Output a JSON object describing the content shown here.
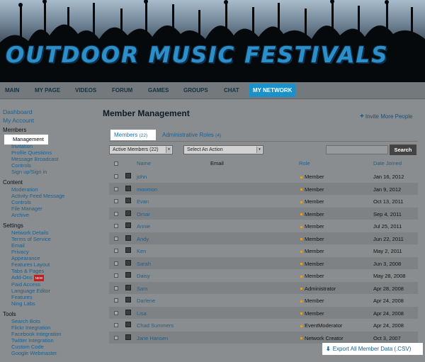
{
  "banner": {
    "title": "OUTDOOR MUSIC FESTIVALS"
  },
  "nav": {
    "items": [
      {
        "label": "MAIN"
      },
      {
        "label": "MY PAGE"
      },
      {
        "label": "VIDEOS"
      },
      {
        "label": "FORUM"
      },
      {
        "label": "GAMES"
      },
      {
        "label": "GROUPS"
      },
      {
        "label": "CHAT"
      },
      {
        "label": "MY NETWORK",
        "active": true
      }
    ]
  },
  "sidebar": {
    "dashboard": "Dashboard",
    "my_account": "My Account",
    "members_heading": "Members",
    "members_items": [
      "Management",
      "Invitation",
      "Profile Questions",
      "Message Broadcast",
      "Controls",
      "Sign up/Sign in"
    ],
    "content_heading": "Content",
    "content_items": [
      "Moderation",
      "Activity Feed Message",
      "Controls",
      "File Manager",
      "Archive"
    ],
    "settings_heading": "Settings",
    "settings_items": [
      "Network Details",
      "Terms of Service",
      "Email",
      "Privacy",
      "Appearance",
      "Features Layout",
      "Tabs & Pages",
      "Add-Ons",
      "Paid Access",
      "Language Editor",
      "Features",
      "Ning Labs"
    ],
    "new_badge": "NEW",
    "tools_heading": "Tools",
    "tools_items": [
      "Search Bots",
      "Flickr Integration",
      "Facebook Integration",
      "Twitter Integration",
      "Custom Code",
      "Google Webmaster"
    ]
  },
  "main": {
    "title": "Member Management",
    "invite_label": "Invite More People",
    "tabs": {
      "members_label": "Members",
      "members_count": "(22)",
      "admin_label": "Administrative Roles",
      "admin_count": "(4)"
    },
    "filter_select": "Active Members (22)",
    "action_select": "Select An Action",
    "search_button": "Search",
    "columns": {
      "name": "Name",
      "email": "Email",
      "role": "Role",
      "date": "Date Joined"
    },
    "members": [
      {
        "name": "john",
        "role": "Member",
        "date": "Jan 16, 2012"
      },
      {
        "name": "monmon",
        "role": "Member",
        "date": "Jan 9, 2012"
      },
      {
        "name": "Evan",
        "role": "Member",
        "date": "Oct 13, 2011"
      },
      {
        "name": "Omar",
        "role": "Member",
        "date": "Sep 4, 2011"
      },
      {
        "name": "Annie",
        "role": "Member",
        "date": "Jul 25, 2011"
      },
      {
        "name": "Andy",
        "role": "Member",
        "date": "Jun 22, 2011"
      },
      {
        "name": "Ken",
        "role": "Member",
        "date": "May 2, 2011"
      },
      {
        "name": "Sarah",
        "role": "Member",
        "date": "Jun 3, 2008"
      },
      {
        "name": "Daisy",
        "role": "Member",
        "date": "May 28, 2008"
      },
      {
        "name": "Sam",
        "role": "Administrator",
        "date": "Apr 28, 2008"
      },
      {
        "name": "Darlene",
        "role": "Member",
        "date": "Apr 24, 2008"
      },
      {
        "name": "Lisa",
        "role": "Member",
        "date": "Apr 24, 2008"
      },
      {
        "name": "Chad Summers",
        "role": "EventModerator",
        "date": "Apr 24, 2008"
      },
      {
        "name": "Jane Hansen",
        "role": "Network Creator",
        "date": "Oct 3, 2007"
      }
    ],
    "export_label": "Export All Member Data (.CSV)"
  }
}
